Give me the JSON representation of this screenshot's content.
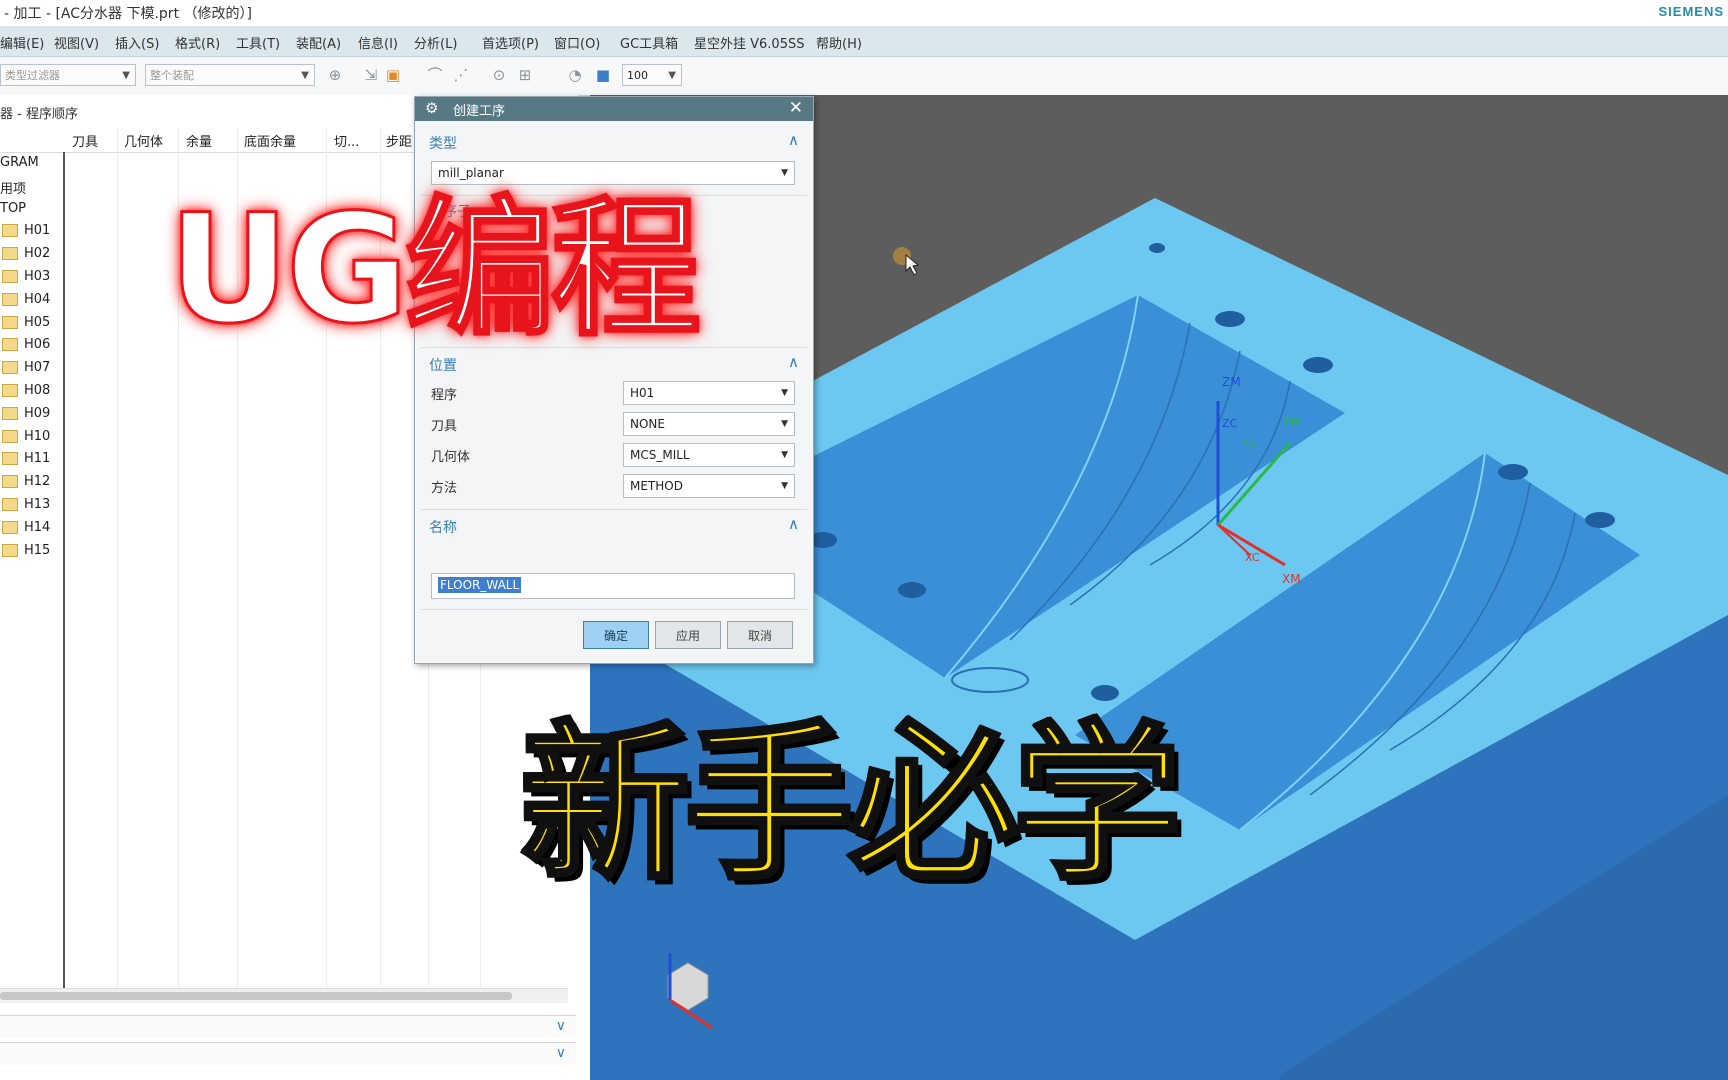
{
  "window": {
    "title": "- 加工 - [AC分水器 下模.prt （修改的）]",
    "brand": "SIEMENS"
  },
  "menubar": {
    "items": [
      "编辑(E)",
      "视图(V)",
      "插入(S)",
      "格式(R)",
      "工具(T)",
      "装配(A)",
      "信息(I)",
      "分析(L)",
      "首选项(P)",
      "窗口(O)",
      "GC工具箱",
      "星空外挂 V6.05SS",
      "帮助(H)"
    ]
  },
  "toolbar": {
    "filter_placeholder": "类型过滤器",
    "scope_placeholder": "整个装配",
    "zoom_value": "100"
  },
  "navigator": {
    "title": "器 - 程序顺序",
    "columns": [
      "刀具",
      "几何体",
      "余量",
      "底面余量",
      "切...",
      "步距"
    ],
    "rows": [
      {
        "label": "GRAM",
        "folder": false
      },
      {
        "label": "用项",
        "folder": false
      },
      {
        "label": "TOP",
        "folder": false
      },
      {
        "label": "H01",
        "folder": true
      },
      {
        "label": "H02",
        "folder": true
      },
      {
        "label": "H03",
        "folder": true
      },
      {
        "label": "H04",
        "folder": true
      },
      {
        "label": "H05",
        "folder": true
      },
      {
        "label": "H06",
        "folder": true
      },
      {
        "label": "H07",
        "folder": true
      },
      {
        "label": "H08",
        "folder": true
      },
      {
        "label": "H09",
        "folder": true
      },
      {
        "label": "H10",
        "folder": true
      },
      {
        "label": "H11",
        "folder": true
      },
      {
        "label": "H12",
        "folder": true
      },
      {
        "label": "H13",
        "folder": true
      },
      {
        "label": "H14",
        "folder": true
      },
      {
        "label": "H15",
        "folder": true
      }
    ]
  },
  "dialog": {
    "title": "创建工序",
    "type_section": "类型",
    "type_value": "mill_planar",
    "subtype_section": "工序子",
    "location_section": "位置",
    "fields": [
      {
        "label": "程序",
        "value": "H01"
      },
      {
        "label": "刀具",
        "value": "NONE"
      },
      {
        "label": "几何体",
        "value": "MCS_MILL"
      },
      {
        "label": "方法",
        "value": "METHOD"
      }
    ],
    "name_section": "名称",
    "name_value": "FLOOR_WALL",
    "buttons": {
      "ok": "确定",
      "apply": "应用",
      "cancel": "取消"
    }
  },
  "viewport": {
    "axes": {
      "zm": "ZM",
      "zc": "ZC",
      "yc": "YC",
      "ym": "YM",
      "xc": "XC",
      "xm": "XM"
    },
    "part_color": "#6cc8f0",
    "background": "#5d5d5d"
  },
  "overlay": {
    "title": "UG编程",
    "subtitle": "新手必学"
  }
}
